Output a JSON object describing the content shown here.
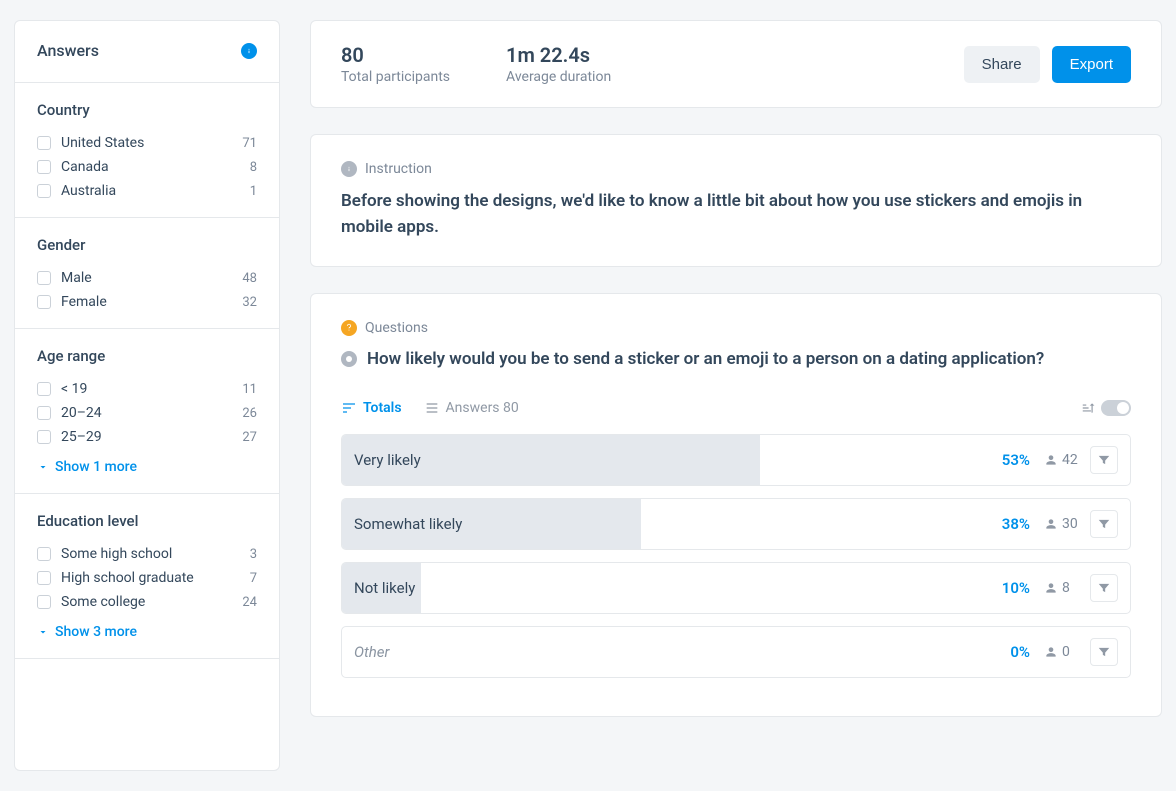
{
  "sidebar": {
    "title": "Answers",
    "sections": [
      {
        "title": "Country",
        "items": [
          {
            "label": "United States",
            "count": 71
          },
          {
            "label": "Canada",
            "count": 8
          },
          {
            "label": "Australia",
            "count": 1
          }
        ],
        "show_more": null
      },
      {
        "title": "Gender",
        "items": [
          {
            "label": "Male",
            "count": 48
          },
          {
            "label": "Female",
            "count": 32
          }
        ],
        "show_more": null
      },
      {
        "title": "Age range",
        "items": [
          {
            "label": "< 19",
            "count": 11
          },
          {
            "label": "20–24",
            "count": 26
          },
          {
            "label": "25–29",
            "count": 27
          }
        ],
        "show_more": "Show 1 more"
      },
      {
        "title": "Education level",
        "items": [
          {
            "label": "Some high school",
            "count": 3
          },
          {
            "label": "High school graduate",
            "count": 7
          },
          {
            "label": "Some college",
            "count": 24
          }
        ],
        "show_more": "Show 3 more"
      }
    ]
  },
  "header": {
    "participants_value": "80",
    "participants_label": "Total participants",
    "duration_value": "1m 22.4s",
    "duration_label": "Average duration",
    "share_label": "Share",
    "export_label": "Export"
  },
  "instruction": {
    "tag": "Instruction",
    "text": "Before showing the designs, we'd like to know a little bit about how you use stickers and emojis in mobile apps."
  },
  "questions": {
    "tag": "Questions",
    "title": "How likely would you be to send a sticker or an emoji to a person on a dating application?",
    "tabs": {
      "totals": "Totals",
      "answers": "Answers 80"
    },
    "answers": [
      {
        "label": "Very likely",
        "percent": "53%",
        "count": 42,
        "bar": 53,
        "muted": false
      },
      {
        "label": "Somewhat likely",
        "percent": "38%",
        "count": 30,
        "bar": 38,
        "muted": false
      },
      {
        "label": "Not likely",
        "percent": "10%",
        "count": 8,
        "bar": 10,
        "muted": false
      },
      {
        "label": "Other",
        "percent": "0%",
        "count": 0,
        "bar": 0,
        "muted": true
      }
    ]
  }
}
